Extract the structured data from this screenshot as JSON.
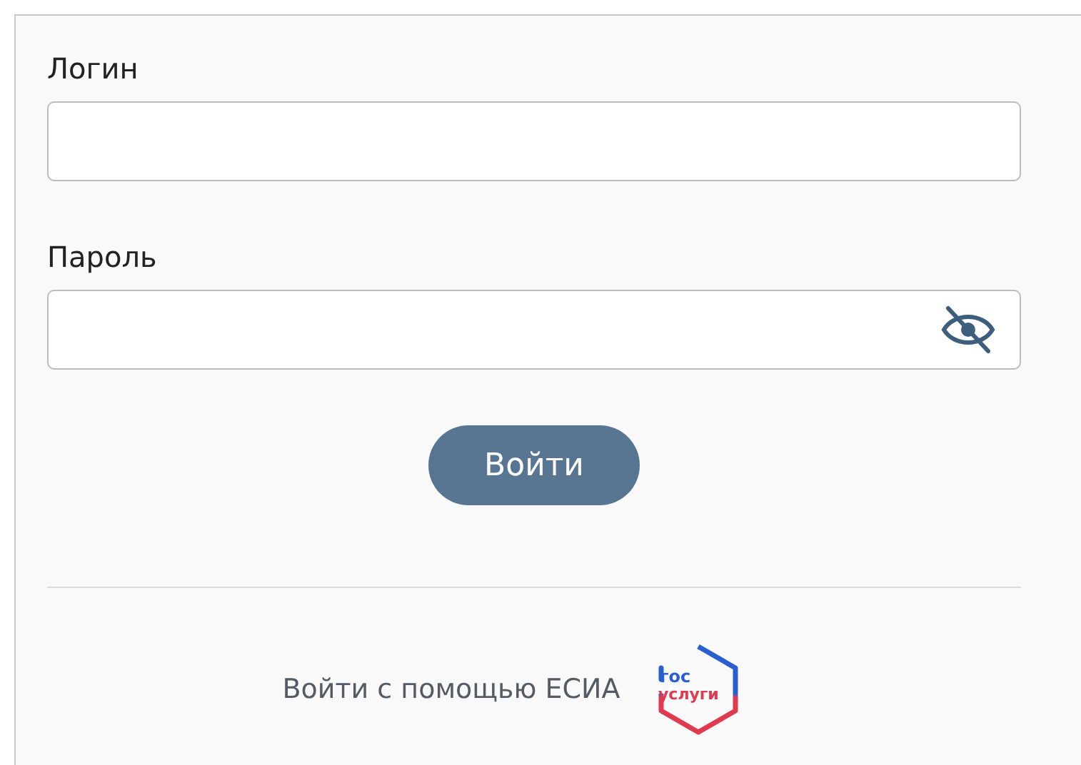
{
  "login": {
    "label": "Логин"
  },
  "password": {
    "label": "Пароль",
    "masked": true
  },
  "submit": {
    "label": "Войти"
  },
  "esia": {
    "text": "Войти с помощью ЕСИА",
    "logo_top": "гос",
    "logo_bottom": "услуги"
  }
}
